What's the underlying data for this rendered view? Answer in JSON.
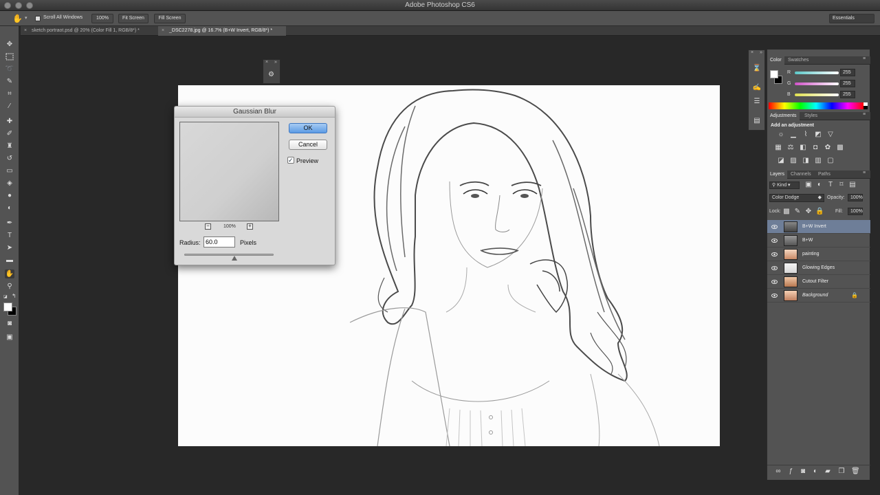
{
  "app": {
    "title": "Adobe Photoshop CS6"
  },
  "options_bar": {
    "scroll_all_windows": "Scroll All Windows",
    "btn_100": "100%",
    "btn_fit": "Fit Screen",
    "btn_fill": "Fill Screen",
    "workspace": "Essentials"
  },
  "tabs": [
    {
      "label": "sketch portraot.psd @ 20% (Color Fill 1, RGB/8*) *",
      "close": "×"
    },
    {
      "label": "_DSC2278.jpg @ 16.7% (B+W Invert, RGB/8*) *",
      "close": "×"
    }
  ],
  "dialog": {
    "title": "Gaussian Blur",
    "ok": "OK",
    "cancel": "Cancel",
    "preview": "Preview",
    "preview_checked": true,
    "zoom": "100%",
    "zoom_out": "−",
    "zoom_in": "+",
    "radius_label": "Radius:",
    "radius_value": "60.0",
    "radius_unit": "Pixels",
    "radius_slider_fraction": 0.56
  },
  "color_panel": {
    "tabs": [
      "Color",
      "Swatches"
    ],
    "channels": [
      {
        "label": "R",
        "value": "255",
        "color": "#e06060"
      },
      {
        "label": "G",
        "value": "255",
        "color": "#60c060"
      },
      {
        "label": "B",
        "value": "255",
        "color": "#6080e0"
      }
    ]
  },
  "adjustments_panel": {
    "tabs": [
      "Adjustments",
      "Styles"
    ],
    "heading": "Add an adjustment"
  },
  "layers_panel": {
    "tabs": [
      "Layers",
      "Channels",
      "Paths"
    ],
    "filter": "Kind",
    "blend_mode": "Color Dodge",
    "opacity_label": "Opacity:",
    "opacity": "100%",
    "lock_label": "Lock:",
    "fill_label": "Fill:",
    "fill": "100%",
    "layers": [
      {
        "name": "B+W Invert",
        "selected": true
      },
      {
        "name": "B+W",
        "selected": false
      },
      {
        "name": "painting",
        "selected": false
      },
      {
        "name": "Glowing Edges",
        "selected": false
      },
      {
        "name": "Cutout Filter",
        "selected": false
      },
      {
        "name": "Background",
        "selected": false,
        "locked": true
      }
    ],
    "footer_icons": [
      "link-icon",
      "fx-icon",
      "mask-icon",
      "adjustment-icon",
      "folder-icon",
      "new-layer-icon",
      "trash-icon"
    ]
  },
  "colors": {
    "ui_dark": "#282828",
    "panel": "#535353",
    "selected_layer": "#6e7e98",
    "ok_button": "#5c9be4"
  }
}
